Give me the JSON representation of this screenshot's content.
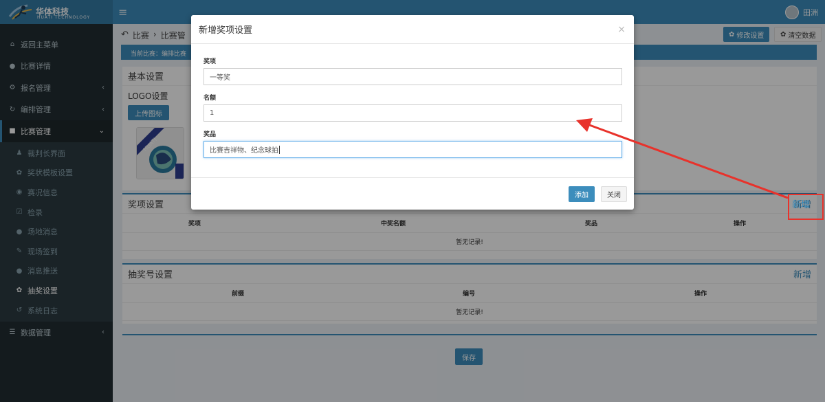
{
  "app": {
    "logo_text": "华体科技",
    "logo_sub": "HUATI TECHNOLOGY",
    "user_name": "田洲"
  },
  "sidebar": {
    "items": [
      {
        "label": "返回主菜单",
        "icon": "home-icon"
      },
      {
        "label": "比赛详情",
        "icon": "info-icon"
      },
      {
        "label": "报名管理",
        "icon": "cogs-icon"
      },
      {
        "label": "编排管理",
        "icon": "refresh-icon"
      },
      {
        "label": "比赛管理",
        "icon": "square-icon"
      }
    ],
    "sub_items": [
      {
        "label": "裁判长界面",
        "icon": "user-icon"
      },
      {
        "label": "奖状模板设置",
        "icon": "gear-icon"
      },
      {
        "label": "赛况信息",
        "icon": "eye-icon"
      },
      {
        "label": "检录",
        "icon": "check-icon"
      },
      {
        "label": "场地消息",
        "icon": "comments-icon"
      },
      {
        "label": "现场签到",
        "icon": "edit-icon"
      },
      {
        "label": "消息推送",
        "icon": "comments-icon"
      },
      {
        "label": "抽奖设置",
        "icon": "gear-icon"
      },
      {
        "label": "系统日志",
        "icon": "history-icon"
      }
    ],
    "bottom_item": {
      "label": "数据管理",
      "icon": "database-icon"
    }
  },
  "breadcrumb": {
    "item1": "比赛",
    "sep": "›",
    "item2": "比赛管"
  },
  "toolbar": {
    "edit_label": "修改设置",
    "clear_label": "清空数据"
  },
  "notice": "当前比赛：编排比赛",
  "basic": {
    "title": "基本设置",
    "logo_label": "LOGO设置",
    "upload_label": "上传图标",
    "thumb_text": "HUATI"
  },
  "prize_section": {
    "title": "奖项设置",
    "add_label": "新增",
    "columns": [
      "奖项",
      "中奖名额",
      "奖品",
      "操作"
    ],
    "empty": "暂无记录!"
  },
  "draw_section": {
    "title": "抽奖号设置",
    "add_label": "新增",
    "columns": [
      "前缀",
      "编号",
      "操作"
    ],
    "empty": "暂无记录!"
  },
  "save_label": "保存",
  "modal": {
    "title": "新增奖项设置",
    "close_glyph": "×",
    "fields": [
      {
        "label": "奖项",
        "value": "一等奖"
      },
      {
        "label": "名额",
        "value": "1"
      },
      {
        "label": "奖品",
        "value": "比赛吉祥物、纪念球拍"
      }
    ],
    "add_label": "添加",
    "close_label": "关闭"
  },
  "colors": {
    "primary": "#3c8dbc",
    "sidebar": "#222d32",
    "annotation": "#e8322b"
  }
}
